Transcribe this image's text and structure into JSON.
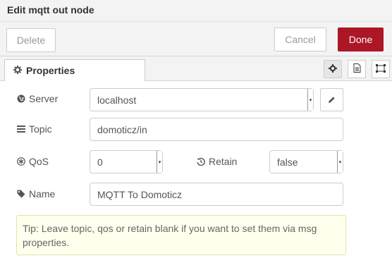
{
  "titlebar": {
    "title": "Edit mqtt out node"
  },
  "toolbar": {
    "delete_label": "Delete",
    "cancel_label": "Cancel",
    "done_label": "Done"
  },
  "tabs": {
    "properties_label": "Properties"
  },
  "form": {
    "server": {
      "label": "Server",
      "value": "localhost"
    },
    "topic": {
      "label": "Topic",
      "value": "domoticz/in"
    },
    "qos": {
      "label": "QoS",
      "value": "0"
    },
    "retain": {
      "label": "Retain",
      "value": "false"
    },
    "name": {
      "label": "Name",
      "value": "MQTT To Domoticz"
    }
  },
  "tip": "Tip: Leave topic, qos or retain blank if you want to set them via msg properties.",
  "colors": {
    "done_bg": "#ad1625",
    "tip_bg": "#ffffee",
    "titlebar_bg": "#f3f3f3"
  },
  "icons": [
    "gear-icon",
    "file-icon",
    "node-appearance-icon",
    "globe-icon",
    "tasks-icon",
    "asterisk-icon",
    "history-icon",
    "tag-icon",
    "pencil-icon"
  ]
}
